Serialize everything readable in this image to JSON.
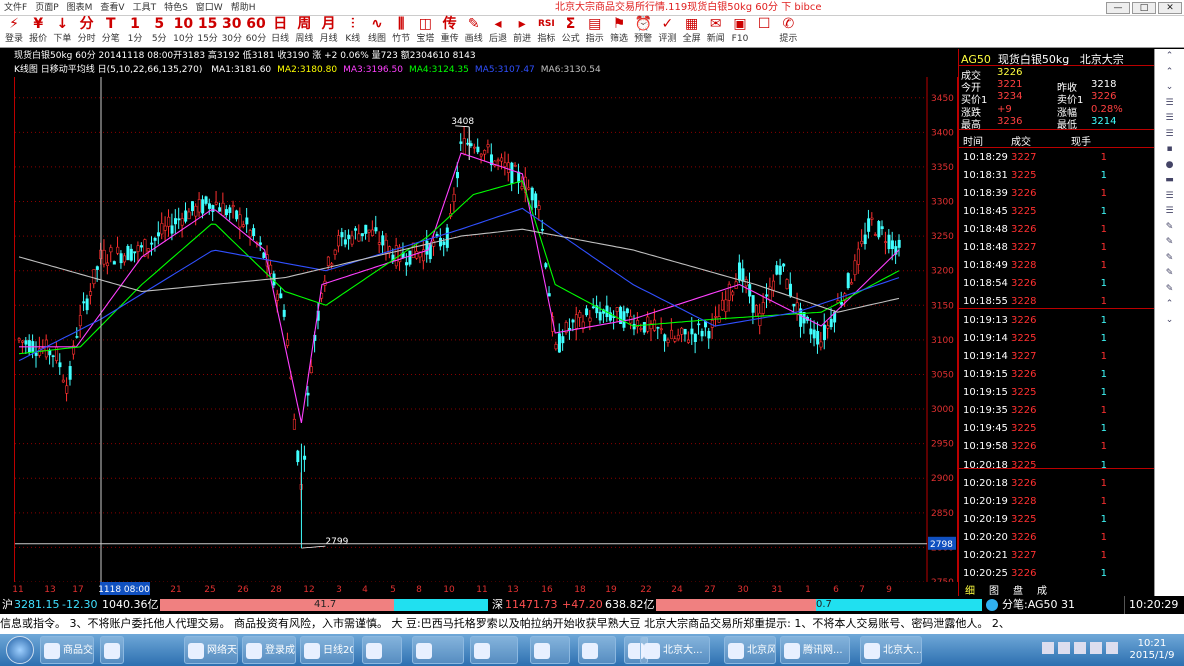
{
  "window": {
    "title": "北京大宗商品交易所行情.119现货白银50kg 60分 下 bibce",
    "menu": [
      "文件F",
      "页面P",
      "图表M",
      "查看V",
      "工具T",
      "特色S",
      "窗口W",
      "帮助H"
    ],
    "controls": [
      "—",
      "□",
      "✕"
    ]
  },
  "toolbar": [
    {
      "icon": "⚡",
      "label": "登录"
    },
    {
      "icon": "¥",
      "label": "报价"
    },
    {
      "icon": "↓",
      "label": "下单"
    },
    {
      "icon": "分",
      "label": "分时"
    },
    {
      "icon": "T",
      "label": "分笔"
    },
    {
      "icon": "1",
      "label": "1分"
    },
    {
      "icon": "5",
      "label": "5分"
    },
    {
      "icon": "10",
      "label": "10分"
    },
    {
      "icon": "15",
      "label": "15分"
    },
    {
      "icon": "30",
      "label": "30分"
    },
    {
      "icon": "60",
      "label": "60分"
    },
    {
      "icon": "日",
      "label": "日线"
    },
    {
      "icon": "周",
      "label": "周线"
    },
    {
      "icon": "月",
      "label": "月线"
    },
    {
      "icon": "⫶",
      "label": "K线"
    },
    {
      "icon": "∿",
      "label": "线图"
    },
    {
      "icon": "⫼",
      "label": "竹节"
    },
    {
      "icon": "◫",
      "label": "宝塔"
    },
    {
      "icon": "传",
      "label": "重传"
    },
    {
      "icon": "✎",
      "label": "画线"
    },
    {
      "icon": "◂",
      "label": "后退"
    },
    {
      "icon": "▸",
      "label": "前进"
    },
    {
      "icon": "RSI",
      "label": "指标"
    },
    {
      "icon": "Σ",
      "label": "公式"
    },
    {
      "icon": "▤",
      "label": "指示"
    },
    {
      "icon": "⚑",
      "label": "筛选"
    },
    {
      "icon": "⏰",
      "label": "预警"
    },
    {
      "icon": "✓",
      "label": "评测"
    },
    {
      "icon": "▦",
      "label": "全屏"
    },
    {
      "icon": "✉",
      "label": "新闻"
    },
    {
      "icon": "▣",
      "label": "F10"
    },
    {
      "icon": "☐",
      "label": ""
    },
    {
      "icon": "✆",
      "label": "提示"
    }
  ],
  "chart_header": {
    "info": "现货白银50kg 60分 20141118 08:00开3183 高3192 低3181 收3190 涨 +2 0.06% 量723 额2304610 8143",
    "indicator": "K线图 日移动平均线 日(5,10,22,66,135,270)",
    "ma": [
      {
        "text": "MA1:3181.60",
        "color": "#ffffff"
      },
      {
        "text": "MA2:3180.80",
        "color": "#ffff00"
      },
      {
        "text": "MA3:3196.50",
        "color": "#ff40ff"
      },
      {
        "text": "MA4:3124.35",
        "color": "#00ff00"
      },
      {
        "text": "MA5:3107.47",
        "color": "#3050ff"
      },
      {
        "text": "MA6:3130.54",
        "color": "#c0c0c0"
      }
    ]
  },
  "chart_data": {
    "type": "candlestick",
    "ylim": [
      2750,
      3480
    ],
    "y_ticks": [
      2750,
      2800,
      2850,
      2900,
      2950,
      3000,
      3050,
      3100,
      3150,
      3200,
      3250,
      3300,
      3350,
      3400,
      3450
    ],
    "x_ticks": [
      "11",
      "13",
      "17",
      "1118 08:00",
      "21",
      "25",
      "26",
      "28",
      "12",
      "3",
      "4",
      "5",
      "8",
      "10",
      "11",
      "13",
      "16",
      "18",
      "19",
      "22",
      "24",
      "27",
      "30",
      "31",
      "1",
      "6",
      "7",
      "9"
    ],
    "annotations": [
      {
        "label": "3408",
        "value": 3408
      },
      {
        "label": "2799",
        "value": 2799
      }
    ],
    "crosshair_value": "2798",
    "candle_count": 260,
    "price_path": [
      [
        0,
        3100
      ],
      [
        18,
        3080
      ],
      [
        24,
        3030
      ],
      [
        28,
        3110
      ],
      [
        40,
        3220
      ],
      [
        60,
        3230
      ],
      [
        80,
        3280
      ],
      [
        95,
        3300
      ],
      [
        110,
        3270
      ],
      [
        120,
        3220
      ],
      [
        130,
        3140
      ],
      [
        134,
        3000
      ],
      [
        138,
        2880
      ],
      [
        142,
        3050
      ],
      [
        148,
        3180
      ],
      [
        155,
        3240
      ],
      [
        170,
        3260
      ],
      [
        185,
        3220
      ],
      [
        200,
        3230
      ],
      [
        210,
        3250
      ],
      [
        216,
        3380
      ],
      [
        222,
        3390
      ],
      [
        232,
        3360
      ],
      [
        246,
        3330
      ],
      [
        254,
        3300
      ],
      [
        258,
        3200
      ],
      [
        262,
        3080
      ],
      [
        266,
        3110
      ],
      [
        280,
        3140
      ],
      [
        300,
        3130
      ],
      [
        320,
        3100
      ],
      [
        340,
        3120
      ],
      [
        352,
        3200
      ],
      [
        362,
        3130
      ],
      [
        372,
        3210
      ],
      [
        382,
        3130
      ],
      [
        392,
        3100
      ],
      [
        400,
        3150
      ],
      [
        408,
        3200
      ],
      [
        416,
        3270
      ],
      [
        424,
        3250
      ],
      [
        430,
        3230
      ]
    ],
    "ma_lines": {
      "ma3": [
        [
          0,
          3090
        ],
        [
          28,
          3090
        ],
        [
          60,
          3220
        ],
        [
          95,
          3290
        ],
        [
          120,
          3230
        ],
        [
          138,
          2980
        ],
        [
          148,
          3180
        ],
        [
          200,
          3230
        ],
        [
          216,
          3370
        ],
        [
          246,
          3340
        ],
        [
          262,
          3110
        ],
        [
          300,
          3130
        ],
        [
          352,
          3180
        ],
        [
          392,
          3120
        ],
        [
          430,
          3230
        ]
      ],
      "ma4": [
        [
          0,
          3080
        ],
        [
          30,
          3090
        ],
        [
          60,
          3180
        ],
        [
          95,
          3270
        ],
        [
          130,
          3170
        ],
        [
          150,
          3150
        ],
        [
          200,
          3250
        ],
        [
          222,
          3310
        ],
        [
          246,
          3330
        ],
        [
          262,
          3180
        ],
        [
          300,
          3120
        ],
        [
          340,
          3130
        ],
        [
          392,
          3140
        ],
        [
          430,
          3200
        ]
      ],
      "ma5": [
        [
          0,
          3070
        ],
        [
          40,
          3130
        ],
        [
          95,
          3230
        ],
        [
          150,
          3200
        ],
        [
          216,
          3260
        ],
        [
          246,
          3290
        ],
        [
          300,
          3180
        ],
        [
          340,
          3120
        ],
        [
          380,
          3140
        ],
        [
          430,
          3190
        ]
      ],
      "ma6": [
        [
          0,
          3220
        ],
        [
          60,
          3170
        ],
        [
          130,
          3190
        ],
        [
          216,
          3250
        ],
        [
          246,
          3260
        ],
        [
          300,
          3230
        ],
        [
          360,
          3180
        ],
        [
          400,
          3140
        ],
        [
          430,
          3160
        ]
      ]
    }
  },
  "quote": {
    "symbol": "AG50",
    "name": "现货白银50kg",
    "exchange": "北京大宗",
    "rows": [
      {
        "label": "成交",
        "value": "3226"
      },
      {
        "label": "今开",
        "value": "3221",
        "label2": "昨收",
        "value2": "3218"
      },
      {
        "label": "买价1",
        "value": "3234",
        "label2": "卖价1",
        "value2": "3226"
      },
      {
        "label": "涨跌",
        "value": "+9",
        "label2": "涨幅",
        "value2": "0.28%"
      },
      {
        "label": "最高",
        "value": "3236",
        "label2": "最低",
        "value2": "3214"
      }
    ]
  },
  "ticks": {
    "headers": [
      "时间",
      "成交",
      "现手"
    ],
    "rows": [
      [
        "10:18:29",
        "3227",
        "1",
        "r"
      ],
      [
        "10:18:31",
        "3225",
        "1",
        "c"
      ],
      [
        "10:18:39",
        "3226",
        "1",
        "r"
      ],
      [
        "10:18:45",
        "3225",
        "1",
        "c"
      ],
      [
        "10:18:48",
        "3226",
        "1",
        "r"
      ],
      [
        "10:18:48",
        "3227",
        "1",
        "r"
      ],
      [
        "10:18:49",
        "3228",
        "1",
        "r"
      ],
      [
        "10:18:54",
        "3226",
        "1",
        "c"
      ],
      [
        "10:18:55",
        "3228",
        "1",
        "r"
      ],
      [
        "10:19:13",
        "3226",
        "1",
        "c"
      ],
      [
        "10:19:14",
        "3225",
        "1",
        "c"
      ],
      [
        "10:19:14",
        "3227",
        "1",
        "r"
      ],
      [
        "10:19:15",
        "3226",
        "1",
        "c"
      ],
      [
        "10:19:15",
        "3225",
        "1",
        "c"
      ],
      [
        "10:19:35",
        "3226",
        "1",
        "r"
      ],
      [
        "10:19:45",
        "3225",
        "1",
        "c"
      ],
      [
        "10:19:58",
        "3226",
        "1",
        "r"
      ],
      [
        "10:20:18",
        "3225",
        "1",
        "c"
      ],
      [
        "10:20:18",
        "3226",
        "1",
        "r"
      ],
      [
        "10:20:19",
        "3228",
        "1",
        "r"
      ],
      [
        "10:20:19",
        "3225",
        "1",
        "c"
      ],
      [
        "10:20:20",
        "3226",
        "1",
        "r"
      ],
      [
        "10:20:21",
        "3227",
        "1",
        "r"
      ],
      [
        "10:20:25",
        "3226",
        "1",
        "c"
      ]
    ],
    "tabs": [
      "细",
      "图",
      "盘",
      "成"
    ]
  },
  "side_icons": [
    "⌃",
    "⌃",
    "⌄",
    "☰",
    "☰",
    "☰",
    "▪",
    "●",
    "▬",
    "☰",
    "☰",
    "✎",
    "✎",
    "✎",
    "✎",
    "✎",
    "⌃",
    "⌄"
  ],
  "status": {
    "sh_label": "沪",
    "sh_value": "3281.15",
    "sh_change": "-12.30",
    "sh_amount": "1040.36亿",
    "sh_bar": "41.7",
    "sz_label": "深",
    "sz_value": "11471.73",
    "sz_change": "+47.20",
    "sz_amount": "638.82亿",
    "sz_bar": "0.7",
    "fenbi": "分笔:AG50 31",
    "time": "10:20:29"
  },
  "ticker": "信息或指令。   3、不将账户委托他人代理交易。   商品投资有风险，入市需谨慎。   大   豆:巴西马托格罗索以及帕拉纳开始收获早熟大豆   北京大宗商品交易所郑重提示:   1、不将本人交易账号、密码泄露他人。   2、",
  "taskbar": {
    "tasks": [
      "商品交...",
      "",
      "网络天...",
      "登录成...",
      "日线20...",
      "",
      "",
      "",
      "",
      "",
      "",
      "北京大...",
      "北京风...",
      "腾讯网...",
      "北京大..."
    ],
    "clock_time": "10:21",
    "clock_date": "2015/1/9"
  }
}
